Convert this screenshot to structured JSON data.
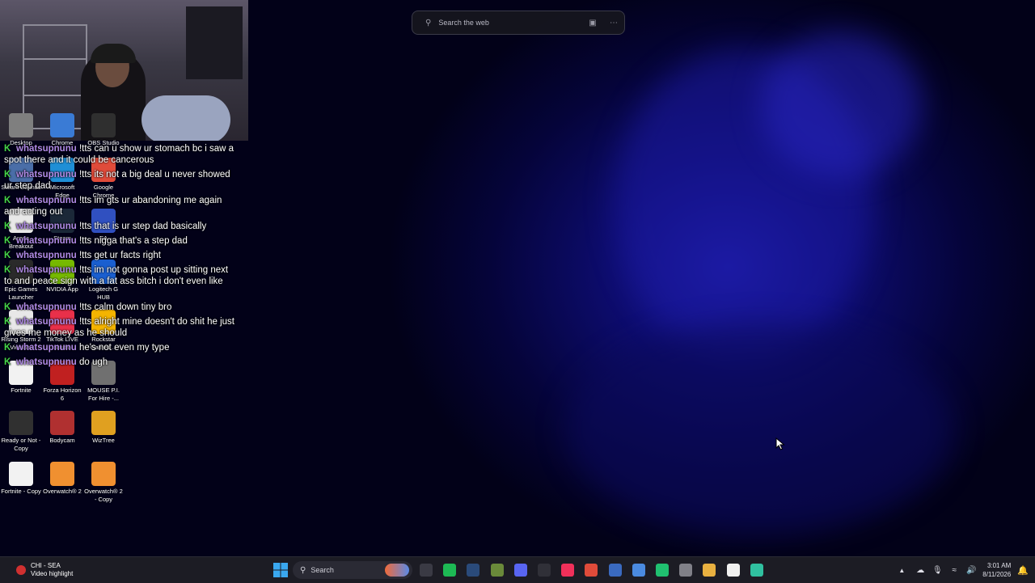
{
  "search": {
    "placeholder": "Search the web"
  },
  "desktop_icons": [
    {
      "label": "Desktop",
      "color": "#7f7f7f"
    },
    {
      "label": "Chrome",
      "color": "#3a7bd5"
    },
    {
      "label": "OBS Studio",
      "color": "#2f2f2f"
    },
    {
      "label": "Steam Sounds",
      "color": "#4a6ea8"
    },
    {
      "label": "Microsoft Edge",
      "color": "#1f8fd6"
    },
    {
      "label": "Google Chrome",
      "color": "#e04b3a"
    },
    {
      "label": "Arena Breakout",
      "color": "#e8e8e8"
    },
    {
      "label": "Steam",
      "color": "#1b2838"
    },
    {
      "label": "EA",
      "color": "#3050c0"
    },
    {
      "label": "Epic Games Launcher",
      "color": "#2a2a2a"
    },
    {
      "label": "NVIDIA App",
      "color": "#76b900"
    },
    {
      "label": "Logitech G HUB",
      "color": "#1a5fd0"
    },
    {
      "label": "Rising Storm 2 Vietnam",
      "color": "#e8e8e8"
    },
    {
      "label": "TikTok LIVE Studio",
      "color": "#e8304a"
    },
    {
      "label": "Rockstar Games ...",
      "color": "#f4b400"
    },
    {
      "label": "Fortnite",
      "color": "#f2f2f2"
    },
    {
      "label": "Forza Horizon 6",
      "color": "#c02020"
    },
    {
      "label": "MOUSE P.I. For Hire -...",
      "color": "#707070"
    },
    {
      "label": "Ready or Not - Copy",
      "color": "#303030"
    },
    {
      "label": "Bodycam",
      "color": "#b03030"
    },
    {
      "label": "WizTree",
      "color": "#e0a020"
    },
    {
      "label": "Fortnite - Copy",
      "color": "#f2f2f2"
    },
    {
      "label": "Overwatch® 2",
      "color": "#f09030"
    },
    {
      "label": "Overwatch® 2 - Copy",
      "color": "#f09030"
    }
  ],
  "chat": [
    {
      "badge": "K",
      "user": "whatsupnunu",
      "text": "!tts can u show ur stomach bc i saw a spot there and it could be cancerous"
    },
    {
      "badge": "K",
      "user": "whatsupnunu",
      "text": "!tts its not a big deal u never showed ur step dad"
    },
    {
      "badge": "K",
      "user": "whatsupnunu",
      "text": "!tts im gts ur abandoning me again and acting out"
    },
    {
      "badge": "K",
      "user": "whatsupnunu",
      "text": "!tts that is ur step dad basically"
    },
    {
      "badge": "K",
      "user": "whatsupnunu",
      "text": "!tts nigga that's a step dad"
    },
    {
      "badge": "K",
      "user": "whatsupnunu",
      "text": "!tts get ur facts right"
    },
    {
      "badge": "K",
      "user": "whatsupnunu",
      "text": "!tts im not gonna post up sitting next to and peace sign with a fat ass bitch i don't even like"
    },
    {
      "badge": "K",
      "user": "whatsupnunu",
      "text": "!tts calm down tiny bro"
    },
    {
      "badge": "K",
      "user": "whatsupnunu",
      "text": "!tts alright mine doesn't do shit he just gives me money as he should"
    },
    {
      "badge": "K",
      "user": "whatsupnunu",
      "text": "he's not even my type"
    },
    {
      "badge": "K",
      "user": "whatsupnunu",
      "text": "do ugh"
    }
  ],
  "taskbar": {
    "widget_title": "CHI - SEA",
    "widget_subtitle": "Video highlight",
    "search_label": "Search",
    "apps": [
      {
        "name": "file-explorer-icon",
        "color": "#3a3a44"
      },
      {
        "name": "spotify-icon",
        "color": "#1db954"
      },
      {
        "name": "steam-icon",
        "color": "#2a4a7a"
      },
      {
        "name": "minecraft-icon",
        "color": "#6a8a3a"
      },
      {
        "name": "discord-icon",
        "color": "#5865f2"
      },
      {
        "name": "obs-icon",
        "color": "#303038"
      },
      {
        "name": "itunes-icon",
        "color": "#f0305a"
      },
      {
        "name": "chrome-icon",
        "color": "#e04b3a"
      },
      {
        "name": "app-window-icon",
        "color": "#3a6ac0"
      },
      {
        "name": "notepad-icon",
        "color": "#4a8ae0"
      },
      {
        "name": "green-app-icon",
        "color": "#20c070"
      },
      {
        "name": "grey-app-icon",
        "color": "#808088"
      },
      {
        "name": "folder-icon",
        "color": "#e8b040"
      },
      {
        "name": "terminal-icon",
        "color": "#f0f0f0"
      },
      {
        "name": "capcut-icon",
        "color": "#30c0a0"
      }
    ],
    "time": "3:01 AM",
    "date": "8/11/2026"
  }
}
